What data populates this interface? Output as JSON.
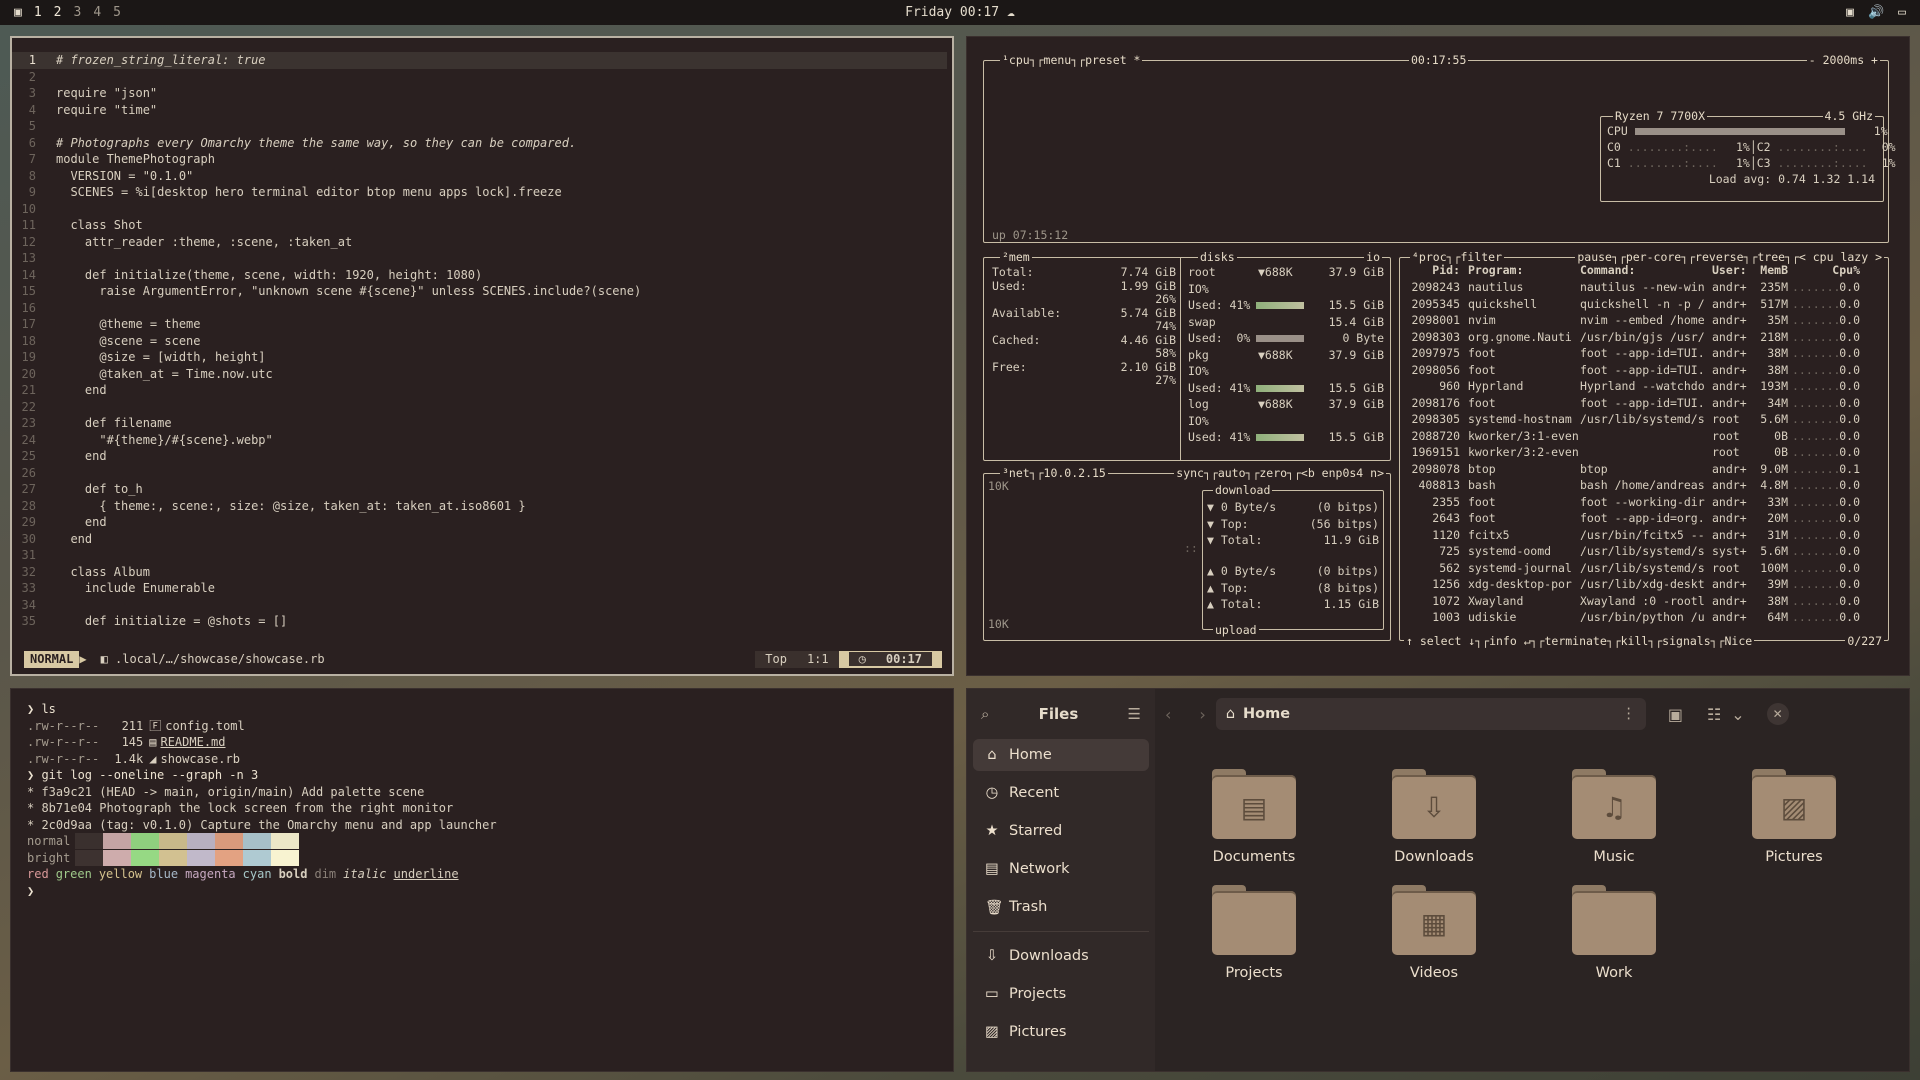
{
  "topbar": {
    "workspaces": [
      "1",
      "2",
      "3",
      "4",
      "5"
    ],
    "clock": "Friday 00:17"
  },
  "editor": {
    "lines": [
      [
        "1",
        "# frozen_string_literal: true"
      ],
      [
        "2",
        ""
      ],
      [
        "3",
        "require \"json\""
      ],
      [
        "4",
        "require \"time\""
      ],
      [
        "5",
        ""
      ],
      [
        "6",
        "# Photographs every Omarchy theme the same way, so they can be compared."
      ],
      [
        "7",
        "module ThemePhotograph"
      ],
      [
        "8",
        "  VERSION = \"0.1.0\""
      ],
      [
        "9",
        "  SCENES = %i[desktop hero terminal editor btop menu apps lock].freeze"
      ],
      [
        "10",
        ""
      ],
      [
        "11",
        "  class Shot"
      ],
      [
        "12",
        "    attr_reader :theme, :scene, :taken_at"
      ],
      [
        "13",
        ""
      ],
      [
        "14",
        "    def initialize(theme, scene, width: 1920, height: 1080)"
      ],
      [
        "15",
        "      raise ArgumentError, \"unknown scene #{scene}\" unless SCENES.include?(scene)"
      ],
      [
        "16",
        ""
      ],
      [
        "17",
        "      @theme = theme"
      ],
      [
        "18",
        "      @scene = scene"
      ],
      [
        "19",
        "      @size = [width, height]"
      ],
      [
        "20",
        "      @taken_at = Time.now.utc"
      ],
      [
        "21",
        "    end"
      ],
      [
        "22",
        ""
      ],
      [
        "23",
        "    def filename"
      ],
      [
        "24",
        "      \"#{theme}/#{scene}.webp\""
      ],
      [
        "25",
        "    end"
      ],
      [
        "26",
        ""
      ],
      [
        "27",
        "    def to_h"
      ],
      [
        "28",
        "      { theme:, scene:, size: @size, taken_at: taken_at.iso8601 }"
      ],
      [
        "29",
        "    end"
      ],
      [
        "30",
        "  end"
      ],
      [
        "31",
        ""
      ],
      [
        "32",
        "  class Album"
      ],
      [
        "33",
        "    include Enumerable"
      ],
      [
        "34",
        ""
      ],
      [
        "35",
        "    def initialize = @shots = []"
      ]
    ],
    "status": {
      "mode": "NORMAL",
      "path": ".local/…/showcase/showcase.rb",
      "pos_label": "Top",
      "cursor": "1:1",
      "time": "00:17"
    }
  },
  "btop": {
    "cpu_box": {
      "title": "¹cpu┐┌menu┐┌preset *",
      "clock": "00:17:55",
      "interval": "- 2000ms +",
      "uptime": "up 07:15:12",
      "model": "Ryzen 7 7700X",
      "freq": "4.5 GHz",
      "cpu_pct": "1%",
      "cores": [
        [
          "C0",
          "1%",
          "C2",
          "0%"
        ],
        [
          "C1",
          "1%",
          "C3",
          "1%"
        ]
      ],
      "load": "Load avg: 0.74 1.32 1.14"
    },
    "mem_box": {
      "title": "²mem",
      "rows": [
        [
          "Total:",
          "7.74 GiB"
        ],
        [
          "Used:",
          "1.99 GiB"
        ],
        [
          "",
          "26%"
        ],
        [
          "Available:",
          "5.74 GiB"
        ],
        [
          "",
          "74%"
        ],
        [
          "Cached:",
          "4.46 GiB"
        ],
        [
          "",
          "58%"
        ],
        [
          "Free:",
          "2.10 GiB"
        ],
        [
          "",
          "27%"
        ]
      ]
    },
    "disks_box": {
      "title": "disks",
      "io": "io",
      "rows": [
        [
          "root",
          "▼688K",
          "37.9 GiB"
        ],
        [
          "IO%",
          "",
          ""
        ],
        [
          "Used: 41%",
          "",
          "15.5 GiB"
        ],
        [
          "swap",
          "",
          "15.4 GiB"
        ],
        [
          "Used:  0%",
          "",
          "0 Byte"
        ],
        [
          "pkg",
          "▼688K",
          "37.9 GiB"
        ],
        [
          "IO%",
          "",
          ""
        ],
        [
          "Used: 41%",
          "",
          "15.5 GiB"
        ],
        [
          "log",
          "▼688K",
          "37.9 GiB"
        ],
        [
          "IO%",
          "",
          ""
        ],
        [
          "Used: 41%",
          "",
          "15.5 GiB"
        ]
      ]
    },
    "net_box": {
      "title": "³net┐┌10.0.2.15",
      "right": "sync┐┌auto┐┌zero┐┌<b enp0s4 n>",
      "scale_top": "10K",
      "scale_bottom": "10K",
      "download": "download",
      "upload": "upload",
      "down_rows": [
        [
          "▼ 0 Byte/s",
          "(0 bitps)"
        ],
        [
          "▼ Top:",
          "(56 bitps)"
        ],
        [
          "▼ Total:",
          "11.9 GiB"
        ]
      ],
      "up_rows": [
        [
          "▲ 0 Byte/s",
          "(0 bitps)"
        ],
        [
          "▲ Top:",
          "(8 bitps)"
        ],
        [
          "▲ Total:",
          "1.15 GiB"
        ]
      ]
    },
    "proc_box": {
      "title": "⁴proc┐┌filter",
      "opts": "pause┐┌per-core┐┌reverse┐┌tree┐┌< cpu lazy >",
      "headers": [
        "Pid:",
        "Program:",
        "Command:",
        "User:",
        "MemB",
        "Cpu%"
      ],
      "rows": [
        [
          "2098243",
          "nautilus",
          "nautilus --new-win",
          "andr+",
          "235M",
          "0.0"
        ],
        [
          "2095345",
          "quickshell",
          "quickshell -n -p /",
          "andr+",
          "517M",
          "0.0"
        ],
        [
          "2098001",
          "nvim",
          "nvim --embed /home",
          "andr+",
          "35M",
          "0.0"
        ],
        [
          "2098303",
          "org.gnome.Nauti",
          "/usr/bin/gjs /usr/",
          "andr+",
          "218M",
          "0.0"
        ],
        [
          "2097975",
          "foot",
          "foot --app-id=TUI.",
          "andr+",
          "38M",
          "0.0"
        ],
        [
          "2098056",
          "foot",
          "foot --app-id=TUI.",
          "andr+",
          "38M",
          "0.0"
        ],
        [
          "960",
          "Hyprland",
          "Hyprland --watchdo",
          "andr+",
          "193M",
          "0.0"
        ],
        [
          "2098176",
          "foot",
          "foot --app-id=TUI.",
          "andr+",
          "34M",
          "0.0"
        ],
        [
          "2098305",
          "systemd-hostnam",
          "/usr/lib/systemd/s",
          "root",
          "5.6M",
          "0.0"
        ],
        [
          "2088720",
          "kworker/3:1-even",
          "",
          "root",
          "0B",
          "0.0"
        ],
        [
          "1969151",
          "kworker/3:2-even",
          "",
          "root",
          "0B",
          "0.0"
        ],
        [
          "2098078",
          "btop",
          "btop",
          "andr+",
          "9.0M",
          "0.1"
        ],
        [
          "408813",
          "bash",
          "bash /home/andreas",
          "andr+",
          "4.8M",
          "0.0"
        ],
        [
          "2355",
          "foot",
          "foot --working-dir",
          "andr+",
          "33M",
          "0.0"
        ],
        [
          "2643",
          "foot",
          "foot --app-id=org.",
          "andr+",
          "20M",
          "0.0"
        ],
        [
          "1120",
          "fcitx5",
          "/usr/bin/fcitx5 --",
          "andr+",
          "31M",
          "0.0"
        ],
        [
          "725",
          "systemd-oomd",
          "/usr/lib/systemd/s",
          "syst+",
          "5.6M",
          "0.0"
        ],
        [
          "562",
          "systemd-journal",
          "/usr/lib/systemd/s",
          "root",
          "100M",
          "0.0"
        ],
        [
          "1256",
          "xdg-desktop-por",
          "/usr/lib/xdg-deskt",
          "andr+",
          "39M",
          "0.0"
        ],
        [
          "1072",
          "Xwayland",
          "Xwayland :0 -rootl",
          "andr+",
          "38M",
          "0.0"
        ],
        [
          "1003",
          "udiskie",
          "/usr/bin/python /u",
          "andr+",
          "64M",
          "0.0"
        ]
      ],
      "footer": "↑ select ↓┐┌info ↵┐┌terminate┐┌kill┐┌signals┐┌Nice",
      "count": "0/227"
    }
  },
  "terminal": {
    "lines": [
      {
        "t": "prompt",
        "text": "❯ ls"
      },
      {
        "t": "ls",
        "perm": ".rw-r--r--",
        "size": "211",
        "icon": "🄵",
        "name": "config.toml"
      },
      {
        "t": "ls",
        "perm": ".rw-r--r--",
        "size": "145",
        "icon": "▤",
        "name": "README.md"
      },
      {
        "t": "ls",
        "perm": ".rw-r--r--",
        "size": "1.4k",
        "icon": "◢",
        "name": "showcase.rb"
      },
      {
        "t": "prompt",
        "text": "❯ git log --oneline --graph -n 3"
      },
      {
        "t": "git",
        "text": "* f3a9c21 (HEAD -> main, origin/main) Add palette scene"
      },
      {
        "t": "git",
        "text": "* 8b71e04 Photograph the lock screen from the right monitor"
      },
      {
        "t": "git",
        "text": "* 2c0d9aa (tag: v0.1.0) Capture the Omarchy menu and app launcher"
      },
      {
        "t": "pal",
        "label": "normal"
      },
      {
        "t": "pal",
        "label": "bright"
      },
      {
        "t": "words",
        "words": [
          "red",
          "green",
          "yellow",
          "blue",
          "magenta",
          "cyan",
          "bold",
          "dim",
          "italic",
          "underline"
        ]
      },
      {
        "t": "prompt",
        "text": "❯"
      }
    ],
    "palette_colors": [
      "#3a302e",
      "#c4a4a4",
      "#8fcf7e",
      "#c8b88a",
      "#b8b0c0",
      "#d89a7c",
      "#a7c0c8",
      "#ece7c7"
    ]
  },
  "files": {
    "title": "Files",
    "sidebar": [
      {
        "icon": "home-icon",
        "label": "Home"
      },
      {
        "icon": "recent-icon",
        "label": "Recent"
      },
      {
        "icon": "star-icon",
        "label": "Starred"
      },
      {
        "icon": "network-icon",
        "label": "Network"
      },
      {
        "icon": "trash-icon",
        "label": "Trash"
      },
      {
        "icon": "download-icon",
        "label": "Downloads"
      },
      {
        "icon": "folder-icon",
        "label": "Projects"
      },
      {
        "icon": "image-icon",
        "label": "Pictures"
      }
    ],
    "location": "Home",
    "items": [
      {
        "label": "Documents",
        "icon": "document-icon"
      },
      {
        "label": "Downloads",
        "icon": "download-icon"
      },
      {
        "label": "Music",
        "icon": "music-icon"
      },
      {
        "label": "Pictures",
        "icon": "image-icon"
      },
      {
        "label": "Projects",
        "icon": "folder-icon"
      },
      {
        "label": "Videos",
        "icon": "film-icon"
      },
      {
        "label": "Work",
        "icon": "folder-icon"
      }
    ]
  }
}
